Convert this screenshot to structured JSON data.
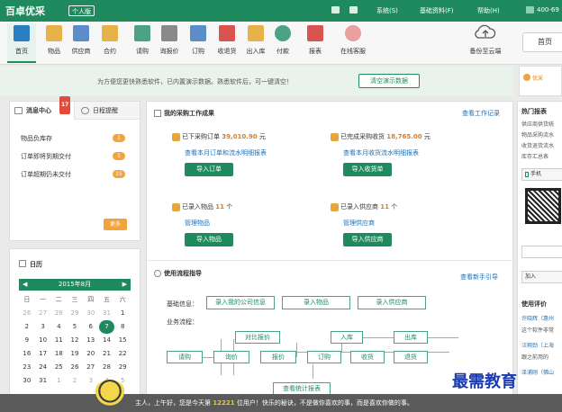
{
  "app": {
    "logo": "百卓优采",
    "edition": "个人版"
  },
  "topmenu": {
    "system": "系统(S)",
    "basic": "基础资料(F)",
    "help": "帮助(H)",
    "phone": "400-69"
  },
  "toolbar": [
    {
      "label": "首页",
      "icon": "home-icon",
      "color": "#2a7fc1"
    },
    {
      "label": "物品",
      "icon": "box-icon",
      "color": "#e8b24a"
    },
    {
      "label": "供应商",
      "icon": "supplier-icon",
      "color": "#5b8dc8"
    },
    {
      "label": "合约",
      "icon": "contract-icon",
      "color": "#e8b24a"
    },
    {
      "label": "请购",
      "icon": "request-icon",
      "color": "#4aa382"
    },
    {
      "label": "询报价",
      "icon": "quote-icon",
      "color": "#8a8a8a"
    },
    {
      "label": "订购",
      "icon": "order-icon",
      "color": "#5b8dc8"
    },
    {
      "label": "收退货",
      "icon": "return-icon",
      "color": "#d9534f"
    },
    {
      "label": "出入库",
      "icon": "warehouse-icon",
      "color": "#e8b24a"
    },
    {
      "label": "付款",
      "icon": "payment-icon",
      "color": "#4aa382"
    },
    {
      "label": "报表",
      "icon": "chart-icon",
      "color": "#d9534f"
    },
    {
      "label": "在线客服",
      "icon": "service-icon",
      "color": "#e8a0a0"
    }
  ],
  "cloud": {
    "label": "备份至云端"
  },
  "home_button": "首页",
  "notice": {
    "text": "为方便您更快熟悉软件，已内置演示数据。熟悉软件后，可一键清空！",
    "button": "清空演示数据",
    "ad": "优采"
  },
  "messages": {
    "tab_center": "消息中心",
    "tab_reminder": "日程提醒",
    "badge": "17",
    "rows": [
      {
        "label": "物品负库存",
        "count": "1"
      },
      {
        "label": "订单即将到期交付",
        "count": "1"
      },
      {
        "label": "订单超期仍未交付",
        "count": "15"
      }
    ],
    "more": "更多"
  },
  "calendar": {
    "title": "日历",
    "month": "2015年8月",
    "weekdays": [
      "日",
      "一",
      "二",
      "三",
      "四",
      "五",
      "六"
    ],
    "weeks": [
      [
        "26",
        "27",
        "28",
        "29",
        "30",
        "31",
        "1"
      ],
      [
        "2",
        "3",
        "4",
        "5",
        "6",
        "7",
        "8"
      ],
      [
        "9",
        "10",
        "11",
        "12",
        "13",
        "14",
        "15"
      ],
      [
        "16",
        "17",
        "18",
        "19",
        "20",
        "21",
        "22"
      ],
      [
        "23",
        "24",
        "25",
        "26",
        "27",
        "28",
        "29"
      ],
      [
        "30",
        "31",
        "1",
        "2",
        "3",
        "4",
        "5"
      ]
    ],
    "today": "7"
  },
  "work": {
    "title": "我的采购工作成果",
    "link": "查看工作记录",
    "order_prefix": "已下采购订单",
    "order_amount": "39,010.90",
    "order_unit": "元",
    "order_link": "查看本月订单和流水明细报表",
    "order_btn": "导入订单",
    "receipt_prefix": "已完成采购收货",
    "receipt_amount": "18,765.00",
    "receipt_unit": "元",
    "receipt_link": "查看本月收货流水明细报表",
    "receipt_btn": "导入收货单",
    "items_prefix": "已录入物品",
    "items_count": "11",
    "items_unit": "个",
    "items_link": "管理物品",
    "items_btn": "导入物品",
    "sup_prefix": "已录入供应商",
    "sup_count": "11",
    "sup_unit": "个",
    "sup_link": "管理供应商",
    "sup_btn": "导入供应商"
  },
  "guide": {
    "title": "使用流程指导",
    "link": "查看新手引导",
    "basic_label": "基础信息：",
    "basic_buttons": [
      "录入我的公司信息",
      "录入物品",
      "录入供应商"
    ],
    "flow_label": "业务流程：",
    "flow": {
      "request": "请购",
      "inquiry": "询价",
      "compare": "对比报价",
      "quote": "报价",
      "order": "订购",
      "receive": "收货",
      "instock": "入库",
      "outstock": "出库",
      "return": "退货",
      "report": "查看统计报表"
    }
  },
  "right": {
    "hot_title": "热门报表",
    "hot_links": [
      "供应商供货统",
      "物品采购流水",
      "收货退货流水",
      "库存汇总表"
    ],
    "phone_tab": "手机",
    "join_btn": "加入",
    "eval_title": "使用评价",
    "evals": [
      "许晓辉（惠州",
      "这个软件非常",
      "汪翔劲（上海",
      "跟之前用的",
      "泽浦刚（佛山"
    ]
  },
  "footer": {
    "prefix": "主人，上午好，您是今天第",
    "visitor_no": "12221",
    "suffix": "位用户！快乐的秘诀，不是做你喜欢的事，而是喜欢你做的事。"
  },
  "watermark": "最需教育"
}
